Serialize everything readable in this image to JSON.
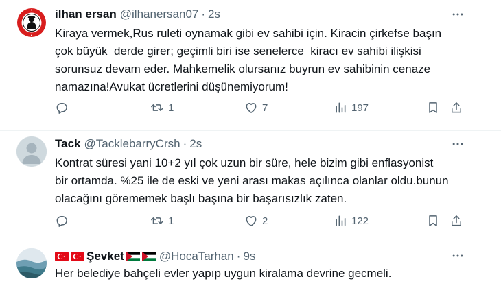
{
  "tweets": [
    {
      "name": "ilhan ersan",
      "handle": "@ilhanersan07",
      "dot": "·",
      "time": "2s",
      "text": "Kiraya vermek,Rus ruleti oynamak gibi ev sahibi için. Kiracin çirkefse başın\nçok büyük  derde girer; geçimli biri ise senelerce  kiracı ev sahibi ilişkisi\nsorunsuz devam eder. Mahkemelik olursanız buyrun ev sahibinin cenaze\nnamazına!Avukat ücretlerini düşünemiyorum!",
      "avatar_logo_text": "ARTVİNSPOR",
      "actions": {
        "reply": "",
        "retweet": "1",
        "like": "7",
        "views": "197"
      }
    },
    {
      "name": "Tack",
      "handle": "@TacklebarryCrsh",
      "dot": "·",
      "time": "2s",
      "text": "Kontrat süresi yani 10+2 yıl çok uzun bir süre, hele bizim gibi enflasyonist\nbir ortamda. %25 ile de eski ve yeni arası makas açılınca olanlar oldu.bunun\nolacağını görememek başlı başına bir başarısızlık zaten.",
      "actions": {
        "reply": "",
        "retweet": "1",
        "like": "2",
        "views": "122"
      }
    },
    {
      "name": "Şevket",
      "handle": "@HocaTarhan",
      "dot": "·",
      "time": "9s",
      "text": "Her belediye bahçeli evler yapıp uygun kiralama devrine gecmeli."
    }
  ],
  "icons": {
    "reply": "reply-icon",
    "retweet": "retweet-icon",
    "like": "heart-icon",
    "views": "views-chart-icon",
    "bookmark": "bookmark-icon",
    "share": "share-icon",
    "more": "more-dots-icon"
  },
  "colors": {
    "text": "#0f1419",
    "secondary": "#536471",
    "divider": "#eff3f4",
    "logo_red": "#d81e1e"
  }
}
